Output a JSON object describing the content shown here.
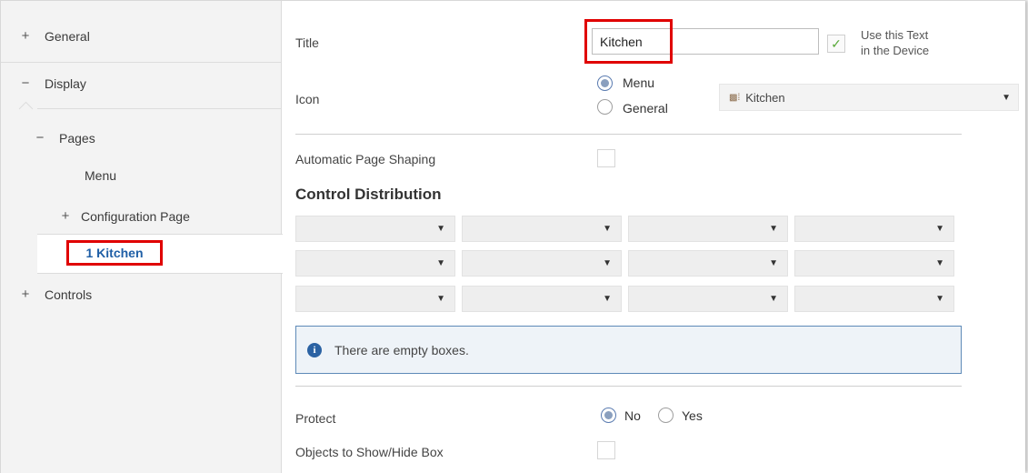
{
  "sidebar": {
    "general": {
      "sign": "+",
      "label": "General"
    },
    "display": {
      "sign": "−",
      "label": "Display"
    },
    "pages": {
      "sign": "−",
      "label": "Pages"
    },
    "menu": {
      "label": "Menu"
    },
    "configuration_page": {
      "sign": "+",
      "label": "Configuration Page"
    },
    "selected_page": {
      "label": "1 Kitchen"
    },
    "controls": {
      "sign": "+",
      "label": "Controls"
    }
  },
  "main": {
    "title": {
      "label": "Title",
      "value": "Kitchen"
    },
    "use_text": {
      "check": "✓",
      "line1": "Use this Text",
      "line2": "in the Device",
      "checked": true
    },
    "icon": {
      "label": "Icon",
      "options": [
        {
          "label": "Menu",
          "selected": true
        },
        {
          "label": "General",
          "selected": false
        }
      ],
      "dropdown_value": "Kitchen",
      "dropdown_icon": "kitchen-icon"
    },
    "automatic_page_shaping": {
      "label": "Automatic Page Shaping",
      "checked": false
    },
    "control_distribution": {
      "heading": "Control Distribution",
      "rows": 3,
      "columns": 4
    },
    "info_message": "There are empty boxes.",
    "protect": {
      "label": "Protect",
      "options": [
        {
          "label": "No",
          "selected": true
        },
        {
          "label": "Yes",
          "selected": false
        }
      ]
    },
    "objects_box": {
      "label": "Objects to Show/Hide Box",
      "checked": false
    }
  },
  "colors": {
    "highlight": "#e00000",
    "selected_text": "#1f5fa6",
    "info_border": "#5e8ab8",
    "check": "#5aaa3a"
  }
}
